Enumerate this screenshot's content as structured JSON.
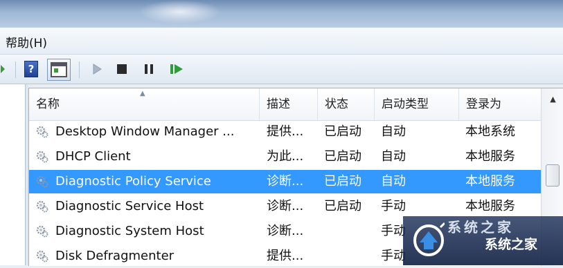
{
  "menu": {
    "help_label": "帮助(H)"
  },
  "toolbar": {
    "help_glyph": "?",
    "items": [
      "help-icon",
      "properties-icon",
      "start-service-icon",
      "stop-service-icon",
      "pause-service-icon",
      "restart-service-icon"
    ]
  },
  "columns": [
    "名称",
    "描述",
    "状态",
    "启动类型",
    "登录为"
  ],
  "services": [
    {
      "name": "Desktop Window Manager ...",
      "description": "提供...",
      "status": "已启动",
      "startup": "自动",
      "logon": "本地系统"
    },
    {
      "name": "DHCP Client",
      "description": "为此...",
      "status": "已启动",
      "startup": "自动",
      "logon": "本地服务"
    },
    {
      "name": "Diagnostic Policy Service",
      "description": "诊断...",
      "status": "已启动",
      "startup": "自动",
      "logon": "本地服务"
    },
    {
      "name": "Diagnostic Service Host",
      "description": "诊断...",
      "status": "已启动",
      "startup": "手动",
      "logon": "本地服务"
    },
    {
      "name": "Diagnostic System Host",
      "description": "诊断...",
      "status": "",
      "startup": "手动",
      "logon": ""
    },
    {
      "name": "Disk Defragmenter",
      "description": "提供...",
      "status": "",
      "startup": "手动",
      "logon": ""
    }
  ],
  "selected_row": 2,
  "watermark": {
    "text": "系统之家",
    "top_text": "系统之家"
  },
  "colors": {
    "selection": "#3399ff",
    "accent": "#1f3f93"
  }
}
